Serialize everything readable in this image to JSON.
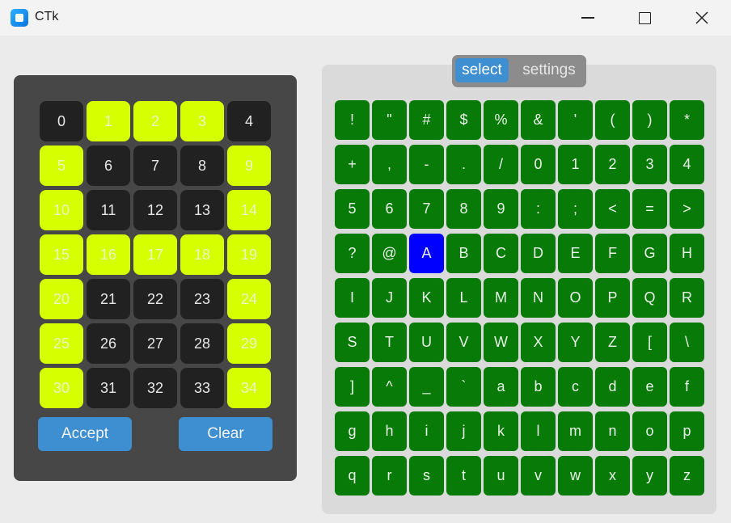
{
  "window": {
    "title": "CTk",
    "icon": "app-icon",
    "controls": [
      "minimize-icon",
      "maximize-icon",
      "close-icon"
    ]
  },
  "number_grid": {
    "buttons": [
      {
        "label": "0",
        "active": false
      },
      {
        "label": "1",
        "active": true
      },
      {
        "label": "2",
        "active": true
      },
      {
        "label": "3",
        "active": true
      },
      {
        "label": "4",
        "active": false
      },
      {
        "label": "5",
        "active": true
      },
      {
        "label": "6",
        "active": false
      },
      {
        "label": "7",
        "active": false
      },
      {
        "label": "8",
        "active": false
      },
      {
        "label": "9",
        "active": true
      },
      {
        "label": "10",
        "active": true
      },
      {
        "label": "11",
        "active": false
      },
      {
        "label": "12",
        "active": false
      },
      {
        "label": "13",
        "active": false
      },
      {
        "label": "14",
        "active": true
      },
      {
        "label": "15",
        "active": true
      },
      {
        "label": "16",
        "active": true
      },
      {
        "label": "17",
        "active": true
      },
      {
        "label": "18",
        "active": true
      },
      {
        "label": "19",
        "active": true
      },
      {
        "label": "20",
        "active": true
      },
      {
        "label": "21",
        "active": false
      },
      {
        "label": "22",
        "active": false
      },
      {
        "label": "23",
        "active": false
      },
      {
        "label": "24",
        "active": true
      },
      {
        "label": "25",
        "active": true
      },
      {
        "label": "26",
        "active": false
      },
      {
        "label": "27",
        "active": false
      },
      {
        "label": "28",
        "active": false
      },
      {
        "label": "29",
        "active": true
      },
      {
        "label": "30",
        "active": true
      },
      {
        "label": "31",
        "active": false
      },
      {
        "label": "32",
        "active": false
      },
      {
        "label": "33",
        "active": false
      },
      {
        "label": "34",
        "active": true
      }
    ],
    "colors": {
      "active": "#d6ff00",
      "inactive": "#212121"
    }
  },
  "actions": {
    "accept_label": "Accept",
    "clear_label": "Clear"
  },
  "tabs": [
    {
      "label": "select",
      "selected": true
    },
    {
      "label": "settings",
      "selected": false
    }
  ],
  "char_grid": {
    "chars": [
      "!",
      "\"",
      "#",
      "$",
      "%",
      "&",
      "'",
      "(",
      ")",
      "*",
      "+",
      ",",
      "-",
      ".",
      "/",
      "0",
      "1",
      "2",
      "3",
      "4",
      "5",
      "6",
      "7",
      "8",
      "9",
      ":",
      ";",
      "<",
      "=",
      ">",
      "?",
      "@",
      "A",
      "B",
      "C",
      "D",
      "E",
      "F",
      "G",
      "H",
      "I",
      "J",
      "K",
      "L",
      "M",
      "N",
      "O",
      "P",
      "Q",
      "R",
      "S",
      "T",
      "U",
      "V",
      "W",
      "X",
      "Y",
      "Z",
      "[",
      "\\",
      "]",
      "^",
      "_",
      "`",
      "a",
      "b",
      "c",
      "d",
      "e",
      "f",
      "g",
      "h",
      "i",
      "j",
      "k",
      "l",
      "m",
      "n",
      "o",
      "p",
      "q",
      "r",
      "s",
      "t",
      "u",
      "v",
      "w",
      "x",
      "y",
      "z"
    ],
    "selected": "A",
    "colors": {
      "normal": "#087a08",
      "selected": "#0000ff"
    }
  }
}
